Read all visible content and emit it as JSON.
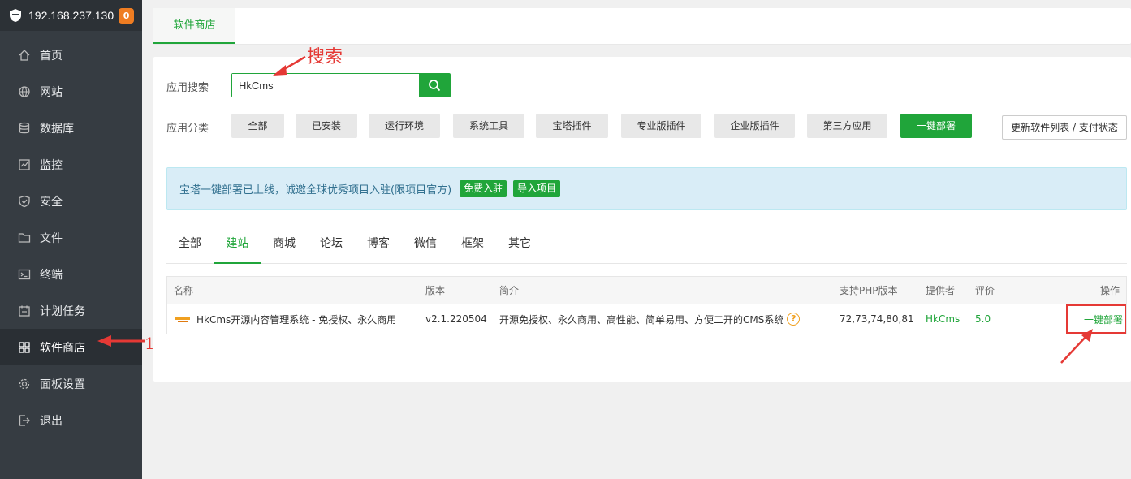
{
  "sidebar": {
    "server_ip": "192.168.237.130",
    "badge": "0",
    "items": [
      {
        "label": "首页",
        "icon": "home-icon"
      },
      {
        "label": "网站",
        "icon": "globe-icon"
      },
      {
        "label": "数据库",
        "icon": "database-icon"
      },
      {
        "label": "监控",
        "icon": "monitor-icon"
      },
      {
        "label": "安全",
        "icon": "shield-icon"
      },
      {
        "label": "文件",
        "icon": "folder-icon"
      },
      {
        "label": "终端",
        "icon": "terminal-icon"
      },
      {
        "label": "计划任务",
        "icon": "calendar-icon"
      },
      {
        "label": "软件商店",
        "icon": "grid-icon",
        "active": true
      },
      {
        "label": "面板设置",
        "icon": "gear-icon"
      },
      {
        "label": "退出",
        "icon": "logout-icon"
      }
    ]
  },
  "topbar": {
    "tab": "软件商店"
  },
  "search": {
    "label": "应用搜索",
    "value": "HkCms"
  },
  "categories": {
    "label": "应用分类",
    "buttons": [
      "全部",
      "已安装",
      "运行环境",
      "系统工具",
      "宝塔插件",
      "专业版插件",
      "企业版插件",
      "第三方应用",
      "一键部署"
    ],
    "refresh": "更新软件列表 / 支付状态"
  },
  "notice": {
    "text": "宝塔一键部署已上线，诚邀全球优秀项目入驻(限项目官方)",
    "btn_join": "免费入驻",
    "btn_import": "导入项目"
  },
  "subtabs": [
    "全部",
    "建站",
    "商城",
    "论坛",
    "博客",
    "微信",
    "框架",
    "其它"
  ],
  "table": {
    "headers": {
      "name": "名称",
      "version": "版本",
      "desc": "简介",
      "php": "支持PHP版本",
      "provider": "提供者",
      "rating": "评价",
      "action": "操作"
    },
    "rows": [
      {
        "name": "HkCms开源内容管理系统 - 免授权、永久商用",
        "version": "v2.1.220504",
        "desc": "开源免授权、永久商用、高性能、简单易用、方便二开的CMS系统",
        "php": "72,73,74,80,81",
        "provider": "HkCms",
        "rating": "5.0",
        "action": "一键部署"
      }
    ]
  },
  "annotations": {
    "search_note": "搜索",
    "step_one": "1"
  },
  "colors": {
    "accent": "#20a53a",
    "sidebar": "#363c42",
    "annotation": "#e53935",
    "badge": "#ef7d22"
  }
}
